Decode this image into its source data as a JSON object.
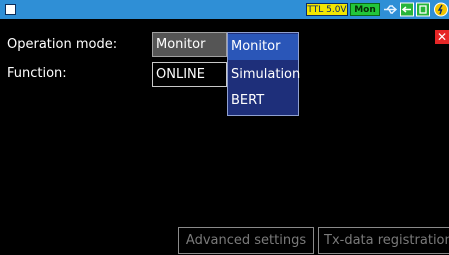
{
  "status_bar": {
    "signal_label": "TTL 5.0V",
    "mode_label": "Mon",
    "icons": [
      "window-icon",
      "usb-icon",
      "plug-icon",
      "card-icon",
      "power-icon"
    ]
  },
  "form": {
    "operation_mode_label": "Operation mode:",
    "operation_mode_value": "Monitor",
    "function_label": "Function:",
    "function_value": "ONLINE"
  },
  "dropdown": {
    "options": [
      "Monitor",
      "Simulation",
      "BERT"
    ],
    "selected": "Monitor"
  },
  "buttons": {
    "advanced_settings": "Advanced settings",
    "tx_data_registration": "Tx-data registration"
  },
  "colors": {
    "top_bar": "#2f8fd6",
    "dropdown_bg": "#1e2f7a",
    "dropdown_selected": "#2a56b8",
    "close": "#e62626",
    "ttl_badge": "#f2e600",
    "mon_badge": "#22c63a"
  }
}
